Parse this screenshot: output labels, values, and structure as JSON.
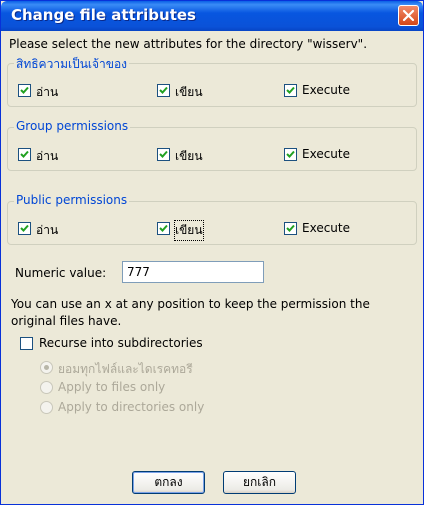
{
  "window": {
    "title": "Change file attributes"
  },
  "prompt": "Please select the new attributes for the directory \"wisserv\".",
  "groups": [
    {
      "title": "สิทธิความเป็นเจ้าของ",
      "read": "อ่าน",
      "write": "เขียน",
      "execute": "Execute"
    },
    {
      "title": "Group permissions",
      "read": "อ่าน",
      "write": "เขียน",
      "execute": "Execute"
    },
    {
      "title": "Public permissions",
      "read": "อ่าน",
      "write": "เขียน",
      "execute": "Execute"
    }
  ],
  "numeric": {
    "label": "Numeric value:",
    "value": "777"
  },
  "hint_line1": "You can use an x at any position to keep the permission the",
  "hint_line2": "original files have.",
  "recurse_label": "Recurse into subdirectories",
  "radios": [
    {
      "label": "ยอมทุกไฟล์และไดเรคทอรี",
      "selected": true
    },
    {
      "label": "Apply to files only",
      "selected": false
    },
    {
      "label": "Apply to directories only",
      "selected": false
    }
  ],
  "buttons": {
    "ok": "ตกลง",
    "cancel": "ยกเลิก"
  },
  "colors": {
    "titlebar": "#0a52d8",
    "group_title": "#0046d5",
    "check": "#21a121"
  }
}
